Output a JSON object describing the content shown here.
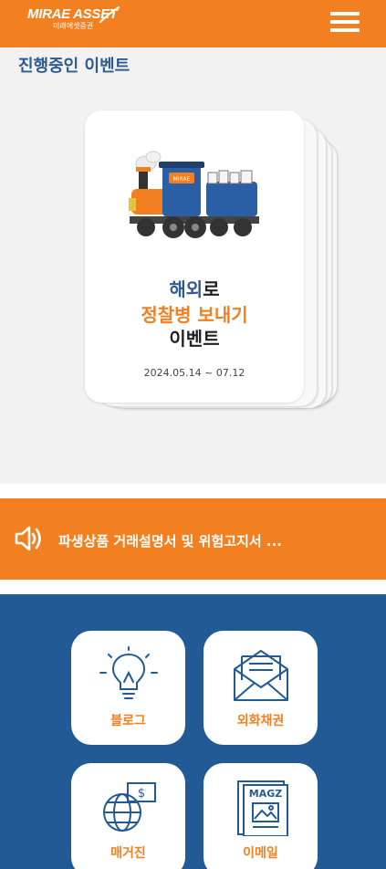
{
  "header": {
    "logo_main": "MIRAE ASSET",
    "logo_sub": "미래에셋증권",
    "menu_icon": "hamburger-menu-icon"
  },
  "events": {
    "section_title": "진행중인 이벤트",
    "card": {
      "line1_highlight": "해외",
      "line1_rest": "로",
      "line2": "정찰병 보내기",
      "line3": "이벤트",
      "date": "2024.05.14 ~ 07.12"
    }
  },
  "notice": {
    "icon": "speaker-icon",
    "text": "파생상품 거래설명서 및 위험고지서 ..."
  },
  "menu": {
    "tiles": [
      {
        "label": "블로그",
        "icon": "lightbulb-icon"
      },
      {
        "label": "외화채권",
        "icon": "envelope-icon"
      },
      {
        "label": "매거진",
        "icon": "globe-money-icon"
      },
      {
        "label": "이메일",
        "icon": "magazine-icon"
      }
    ]
  },
  "colors": {
    "brand_orange": "#f38020",
    "brand_blue": "#215a94",
    "title_blue": "#2f5a8c"
  }
}
